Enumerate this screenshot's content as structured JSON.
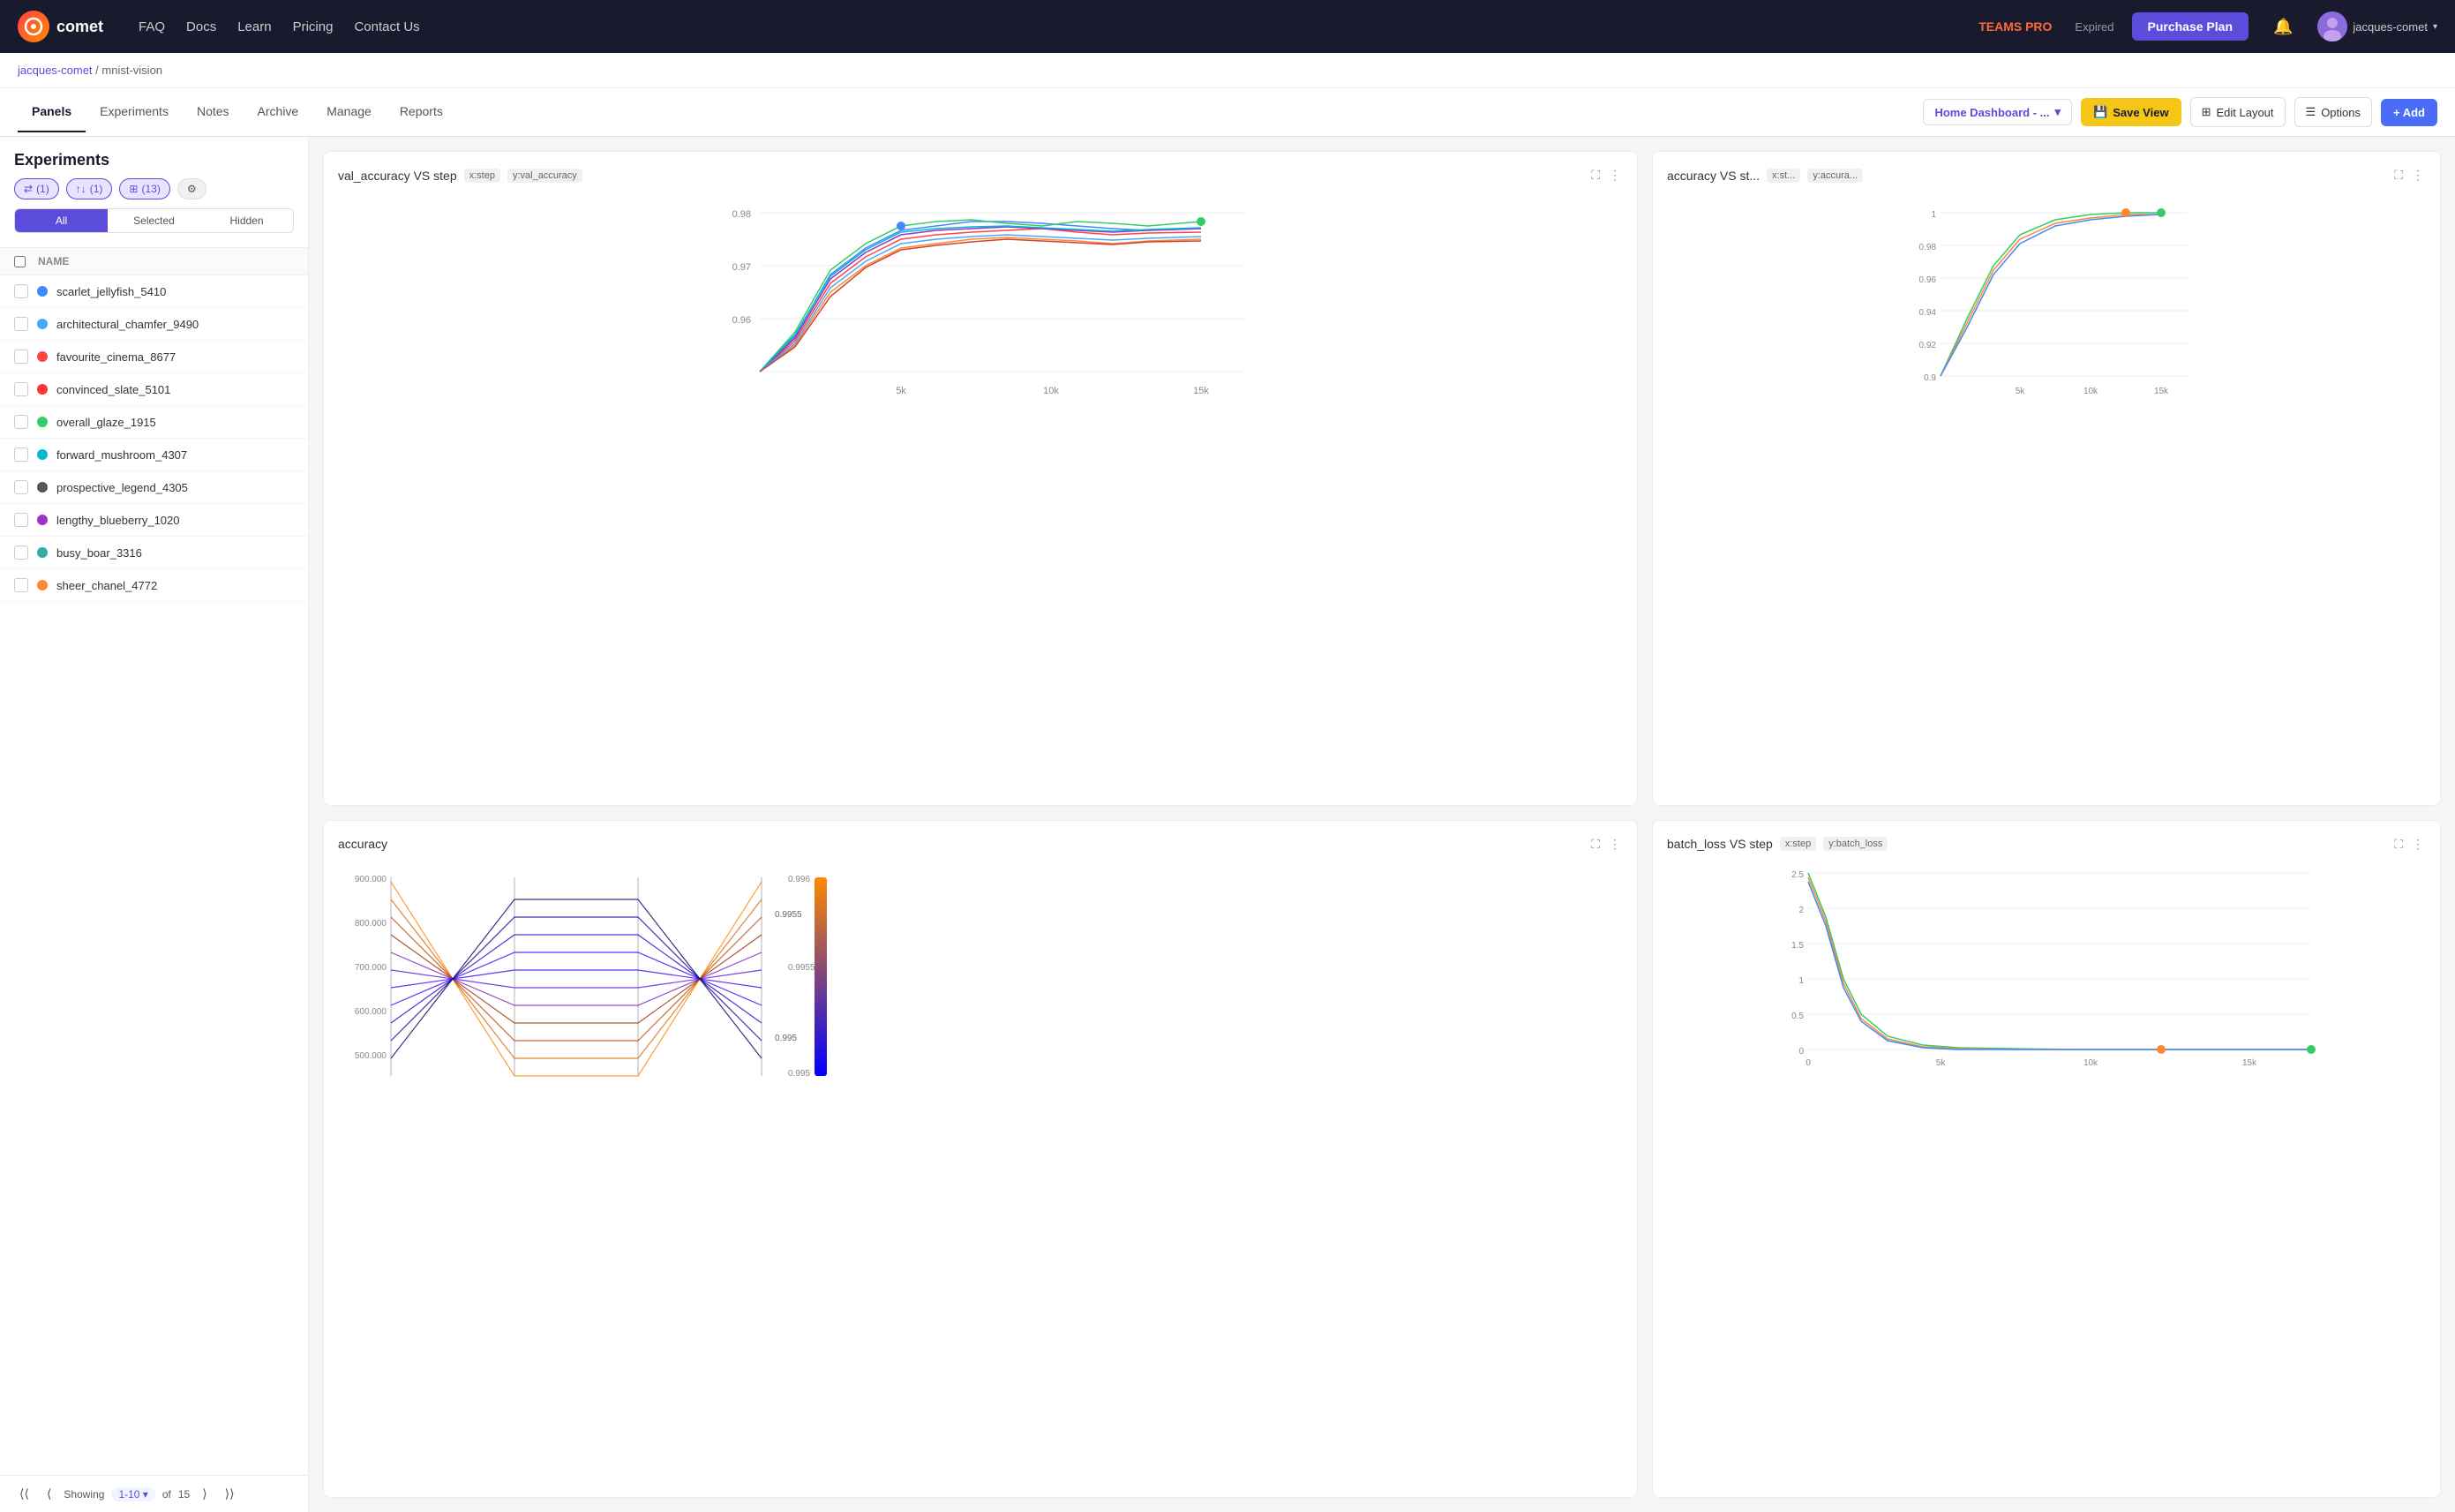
{
  "app": {
    "logo_text": "comet",
    "logo_abbr": "C"
  },
  "nav": {
    "links": [
      "FAQ",
      "Docs",
      "Learn",
      "Pricing",
      "Contact Us"
    ],
    "teams_label": "TEAMS PRO",
    "expired_label": "Expired",
    "purchase_label": "Purchase Plan",
    "user_name": "jacques-comet"
  },
  "breadcrumb": {
    "user": "jacques-comet",
    "separator": "/",
    "project": "mnist-vision"
  },
  "tabs": {
    "items": [
      "Panels",
      "Experiments",
      "Notes",
      "Archive",
      "Manage",
      "Reports"
    ],
    "active": "Panels"
  },
  "toolbar": {
    "dashboard_label": "Home Dashboard - ...",
    "save_view_label": "Save View",
    "edit_layout_label": "Edit Layout",
    "options_label": "Options",
    "add_label": "+ Add"
  },
  "sidebar": {
    "title": "Experiments",
    "filter_chips": [
      {
        "label": "(1)",
        "icon": "filter"
      },
      {
        "label": "(1)",
        "icon": "sort"
      },
      {
        "label": "(13)",
        "icon": "columns"
      }
    ],
    "toggle": {
      "all": "All",
      "selected": "Selected",
      "hidden": "Hidden"
    },
    "column_header": "NAME",
    "experiments": [
      {
        "name": "scarlet_jellyfish_5410",
        "color": "#4488ff",
        "dot_color": "#4488ff"
      },
      {
        "name": "architectural_chamfer_9490",
        "color": "#44aaff",
        "dot_color": "#44aaff"
      },
      {
        "name": "favourite_cinema_8677",
        "color": "#ff4444",
        "dot_color": "#ff4444"
      },
      {
        "name": "convinced_slate_5101",
        "color": "#ff3333",
        "dot_color": "#ff3333"
      },
      {
        "name": "overall_glaze_1915",
        "color": "#33cc66",
        "dot_color": "#33cc66"
      },
      {
        "name": "forward_mushroom_4307",
        "color": "#00bbcc",
        "dot_color": "#00bbcc"
      },
      {
        "name": "prospective_legend_4305",
        "color": "#444444",
        "dot_color": "#444444"
      },
      {
        "name": "lengthy_blueberry_1020",
        "color": "#9933cc",
        "dot_color": "#9933cc"
      },
      {
        "name": "busy_boar_3316",
        "color": "#33aaaa",
        "dot_color": "#33aaaa"
      },
      {
        "name": "sheer_chanel_4772",
        "color": "#ff8833",
        "dot_color": "#ff8833"
      }
    ],
    "pagination": {
      "showing_label": "Showing",
      "range": "1-10",
      "of_label": "of",
      "total": "15"
    }
  },
  "charts": [
    {
      "id": "val_accuracy",
      "title": "val_accuracy VS step",
      "tags": [
        "x:step",
        "y:val_accuracy"
      ],
      "position": "top-left",
      "y_axis": [
        0.98,
        0.97,
        0.96
      ],
      "x_axis": [
        "5k",
        "10k",
        "15k"
      ]
    },
    {
      "id": "accuracy_vs_st",
      "title": "accuracy VS st...",
      "tags": [
        "x:st...",
        "y:accura..."
      ],
      "position": "top-right",
      "y_axis": [
        1,
        0.98,
        0.96,
        0.94,
        0.92,
        0.9
      ],
      "x_axis": [
        "5k",
        "10k",
        "15k"
      ]
    },
    {
      "id": "accuracy_parallel",
      "title": "accuracy",
      "tags": [],
      "position": "bottom-left",
      "y_axis": [
        "900.000",
        "800.000",
        "700.000",
        "600.000",
        "500.000"
      ],
      "color_labels": [
        "0.996",
        "0.9955",
        "0.995"
      ],
      "color_range": [
        "0.996",
        "0.995"
      ]
    },
    {
      "id": "batch_loss",
      "title": "batch_loss VS step",
      "tags": [
        "x:step",
        "y:batch_loss"
      ],
      "position": "bottom-right",
      "y_axis": [
        2.5,
        2,
        1.5,
        1,
        0.5,
        0
      ],
      "x_axis": [
        "0",
        "5k",
        "10k",
        "15k"
      ]
    }
  ]
}
